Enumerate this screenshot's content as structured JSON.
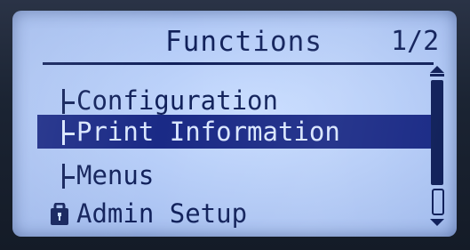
{
  "header": {
    "title": "Functions",
    "page_indicator": "1/2"
  },
  "menu": {
    "items": [
      {
        "label": "Configuration",
        "icon": "tree-branch-icon",
        "selected": false
      },
      {
        "label": "Print Information",
        "icon": "tree-branch-icon",
        "selected": true
      },
      {
        "label": "Menus",
        "icon": "tree-branch-icon",
        "selected": false
      },
      {
        "label": "Admin Setup",
        "icon": "lock-icon",
        "selected": false
      }
    ]
  },
  "colors": {
    "screen_background": "#b5ccf7",
    "text": "#10205a",
    "highlight": "#1a2a86",
    "highlight_text": "#d9e6ff"
  }
}
